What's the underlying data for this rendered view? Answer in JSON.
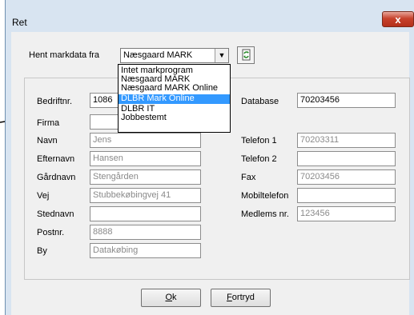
{
  "window": {
    "title": "Ret",
    "close_glyph": "x"
  },
  "source": {
    "label": "Hent markdata fra",
    "selected": "Næsgaard MARK",
    "options": [
      "Intet markprogram",
      "Næsgaard MARK",
      "Næsgaard MARK Online",
      "DLBR Mark Online",
      "DLBR IT",
      "Jobbestemt"
    ],
    "highlighted_index": 3,
    "refresh_icon": "refresh-icon"
  },
  "fields": {
    "bedriftnr": {
      "label": "Bedriftnr.",
      "value": "1086"
    },
    "firma": {
      "label": "Firma",
      "value": ""
    },
    "navn": {
      "label": "Navn",
      "value": "Jens"
    },
    "efternavn": {
      "label": "Efternavn",
      "value": "Hansen"
    },
    "gaardnavn": {
      "label": "Gårdnavn",
      "value": "Stengården"
    },
    "vej": {
      "label": "Vej",
      "value": "Stubbekøbingvej 41"
    },
    "stednavn": {
      "label": "Stednavn",
      "value": ""
    },
    "postnr": {
      "label": "Postnr.",
      "value": "8888"
    },
    "by": {
      "label": "By",
      "value": "Datakøbing"
    },
    "database": {
      "label": "Database",
      "value": "70203456"
    },
    "telefon1": {
      "label": "Telefon 1",
      "value": "70203311"
    },
    "telefon2": {
      "label": "Telefon 2",
      "value": ""
    },
    "fax": {
      "label": "Fax",
      "value": "70203456"
    },
    "mobiltelefon": {
      "label": "Mobiltelefon",
      "value": ""
    },
    "medlemsnr": {
      "label": "Medlems nr.",
      "value": "123456"
    }
  },
  "buttons": {
    "ok_mnemonic": "O",
    "ok_rest": "k",
    "cancel_mnemonic": "F",
    "cancel_rest": "ortryd"
  }
}
